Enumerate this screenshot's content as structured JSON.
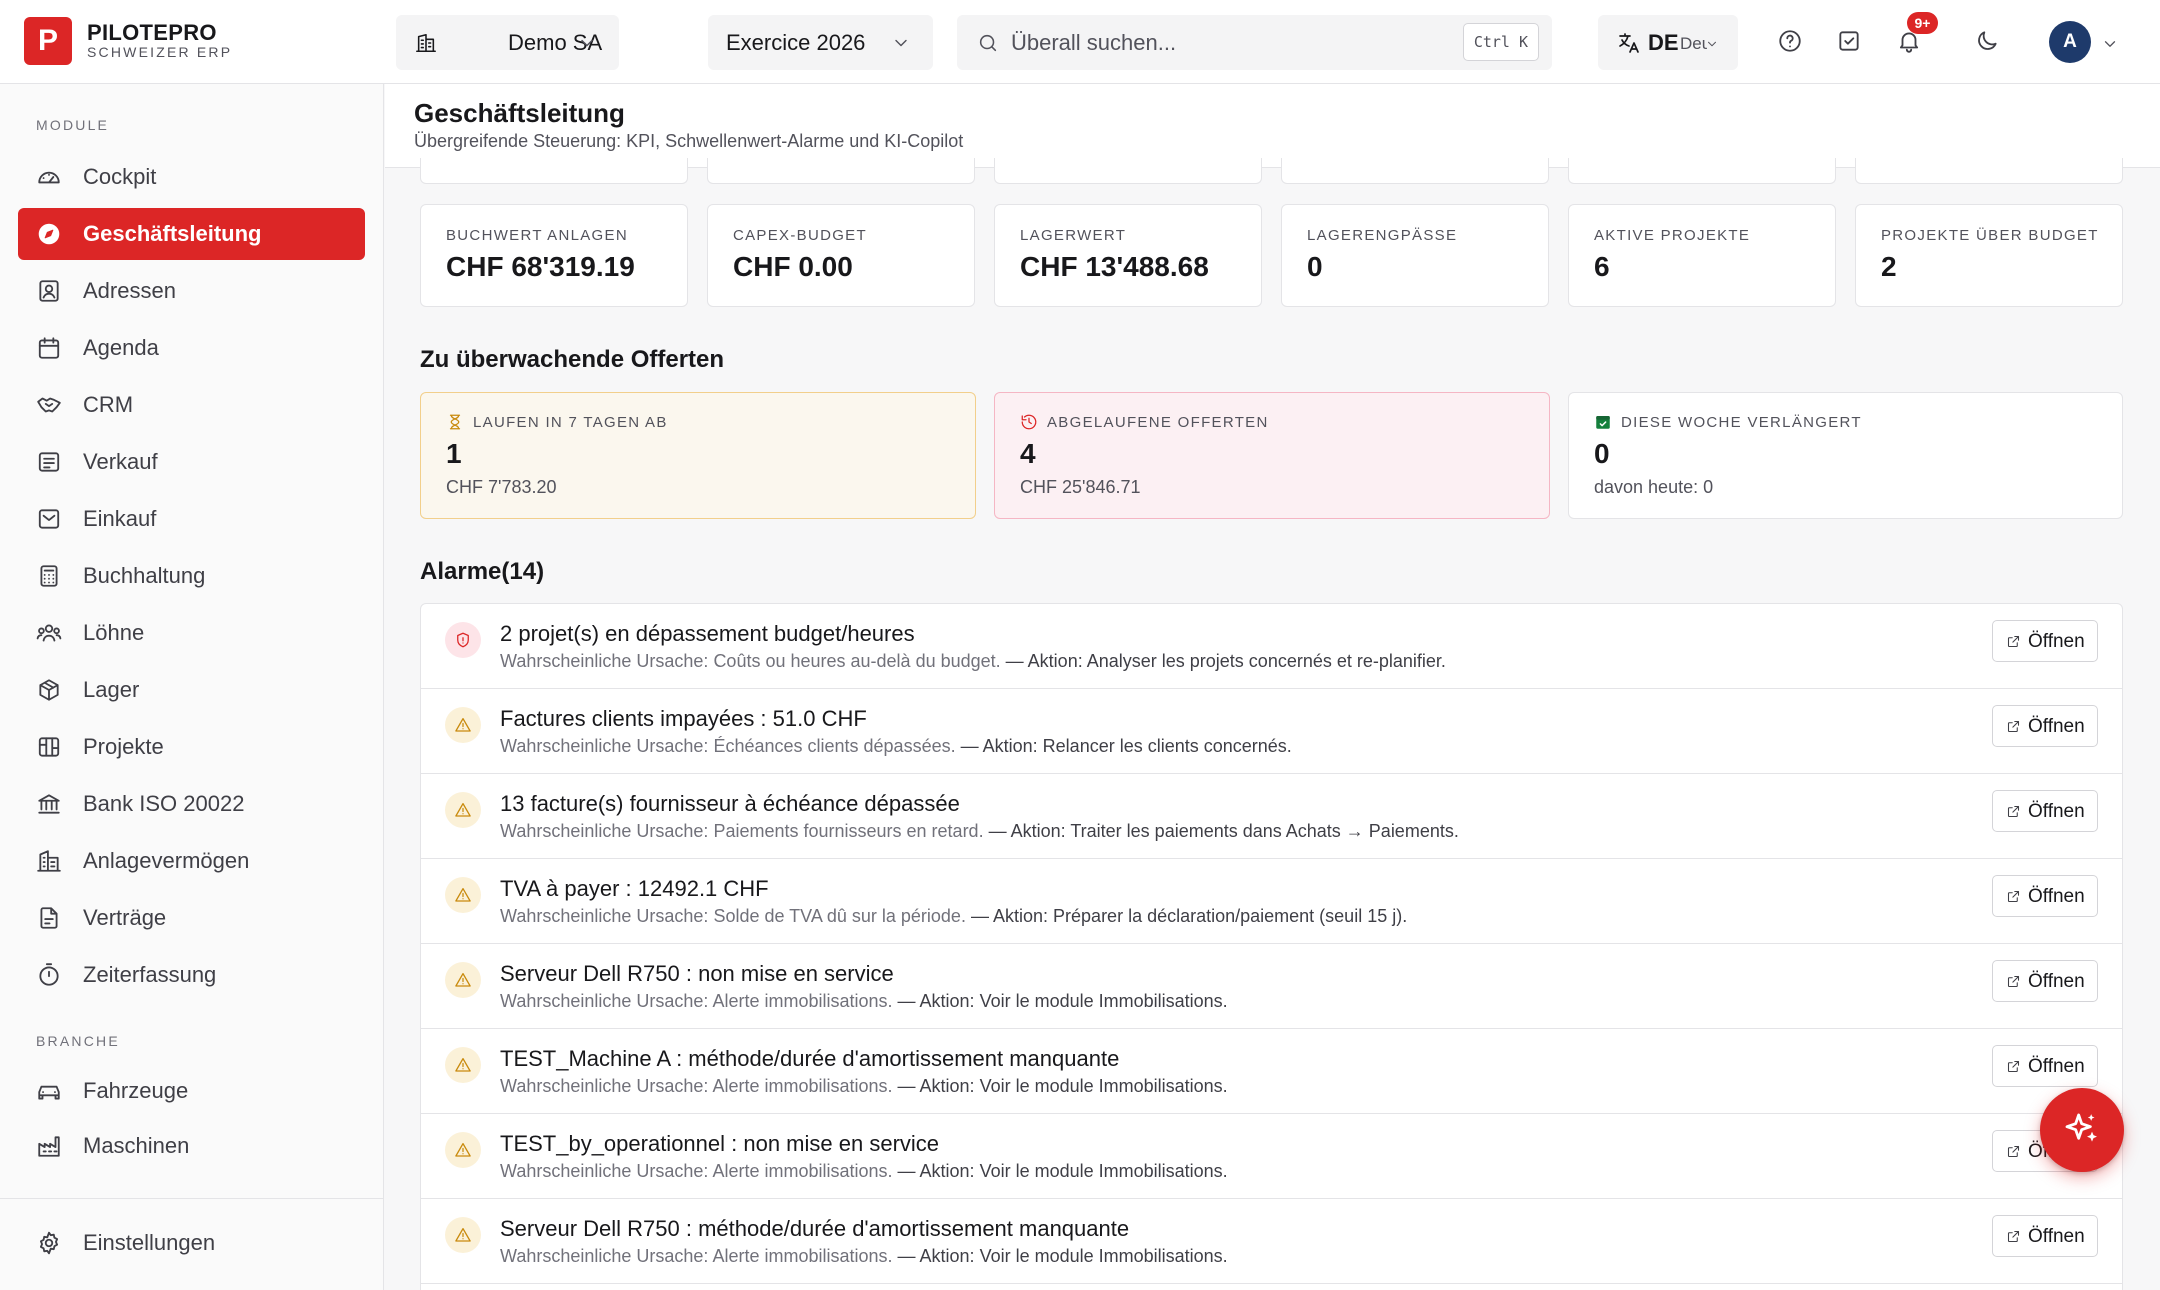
{
  "app": {
    "logo_letter": "P",
    "name": "PILOTEPRO",
    "subtitle": "SCHWEIZER ERP"
  },
  "topbar": {
    "company": "Demo SA",
    "fiscal_year": "Exercice 2026",
    "search_placeholder": "Überall suchen...",
    "search_shortcut": "Ctrl K",
    "language_code": "DE",
    "language_name": "Deutsch",
    "notifications_badge": "9+",
    "user_initial": "A"
  },
  "sidebar": {
    "section_modules": "MODULE",
    "modules": [
      {
        "label": "Cockpit",
        "icon": "gauge-icon"
      },
      {
        "label": "Geschäftsleitung",
        "icon": "compass-icon",
        "active": true
      },
      {
        "label": "Adressen",
        "icon": "contact-icon"
      },
      {
        "label": "Agenda",
        "icon": "calendar-icon"
      },
      {
        "label": "CRM",
        "icon": "handshake-icon"
      },
      {
        "label": "Verkauf",
        "icon": "receipt-icon"
      },
      {
        "label": "Einkauf",
        "icon": "inbox-icon"
      },
      {
        "label": "Buchhaltung",
        "icon": "calculator-icon"
      },
      {
        "label": "Löhne",
        "icon": "users-icon"
      },
      {
        "label": "Lager",
        "icon": "package-icon"
      },
      {
        "label": "Projekte",
        "icon": "kanban-icon"
      },
      {
        "label": "Bank ISO 20022",
        "icon": "bank-icon"
      },
      {
        "label": "Anlagevermögen",
        "icon": "building-icon"
      },
      {
        "label": "Verträge",
        "icon": "contract-icon"
      },
      {
        "label": "Zeiterfassung",
        "icon": "timer-icon"
      }
    ],
    "section_branche": "BRANCHE",
    "branche": [
      {
        "label": "Fahrzeuge",
        "icon": "car-icon"
      },
      {
        "label": "Maschinen",
        "icon": "factory-icon"
      }
    ],
    "settings": {
      "label": "Einstellungen",
      "icon": "gear-icon"
    }
  },
  "page": {
    "title": "Geschäftsleitung",
    "subtitle": "Übergreifende Steuerung: KPI, Schwellenwert-Alarme und KI-Copilot"
  },
  "kpis": [
    {
      "label": "Buchwert Anlagen",
      "value": "CHF 68'319.19"
    },
    {
      "label": "CAPEX-Budget",
      "value": "CHF 0.00"
    },
    {
      "label": "Lagerwert",
      "value": "CHF 13'488.68"
    },
    {
      "label": "Lagerengpässe",
      "value": "0"
    },
    {
      "label": "Aktive Projekte",
      "value": "6"
    },
    {
      "label": "Projekte über Budget",
      "value": "2"
    }
  ],
  "offers": {
    "title": "Zu überwachende Offerten",
    "cards": [
      {
        "label": "Laufen in 7 Tagen ab",
        "value": "1",
        "sub": "CHF 7'783.20",
        "tone": "warn",
        "icon": "hourglass-icon"
      },
      {
        "label": "Abgelaufene Offerten",
        "value": "4",
        "sub": "CHF 25'846.71",
        "tone": "bad",
        "icon": "history-icon"
      },
      {
        "label": "Diese Woche verlängert",
        "value": "0",
        "sub": "davon heute: 0",
        "tone": "ok",
        "icon": "calendar-check-icon"
      }
    ]
  },
  "alarms": {
    "title": "Alarme",
    "count": "(14)",
    "cause_prefix": "Wahrscheinliche Ursache:",
    "action_prefix": "— Aktion:",
    "open_label": "Öffnen",
    "items": [
      {
        "title": "2 projet(s) en dépassement budget/heures",
        "cause": "Coûts ou heures au-delà du budget.",
        "action": "Analyser les projets concernés et re-planifier.",
        "severity": "danger"
      },
      {
        "title": "Factures clients impayées : 51.0 CHF",
        "cause": "Échéances clients dépassées.",
        "action": "Relancer les clients concernés.",
        "severity": "warn"
      },
      {
        "title": "13 facture(s) fournisseur à échéance dépassée",
        "cause": "Paiements fournisseurs en retard.",
        "action": "Traiter les paiements dans Achats → Paiements.",
        "severity": "warn"
      },
      {
        "title": "TVA à payer : 12492.1 CHF",
        "cause": "Solde de TVA dû sur la période.",
        "action": "Préparer la déclaration/paiement (seuil 15 j).",
        "severity": "warn"
      },
      {
        "title": "Serveur Dell R750 : non mise en service",
        "cause": "Alerte immobilisations.",
        "action": "Voir le module Immobilisations.",
        "severity": "warn"
      },
      {
        "title": "TEST_Machine A : méthode/durée d'amortissement manquante",
        "cause": "Alerte immobilisations.",
        "action": "Voir le module Immobilisations.",
        "severity": "warn"
      },
      {
        "title": "TEST_by_operationnel : non mise en service",
        "cause": "Alerte immobilisations.",
        "action": "Voir le module Immobilisations.",
        "severity": "warn"
      },
      {
        "title": "Serveur Dell R750 : méthode/durée d'amortissement manquante",
        "cause": "Alerte immobilisations.",
        "action": "Voir le module Immobilisations.",
        "severity": "warn"
      }
    ]
  },
  "colors": {
    "brand": "#dc2626",
    "warn": "#c98a0d",
    "ok": "#15803d",
    "avatar": "#1e3a6b"
  }
}
